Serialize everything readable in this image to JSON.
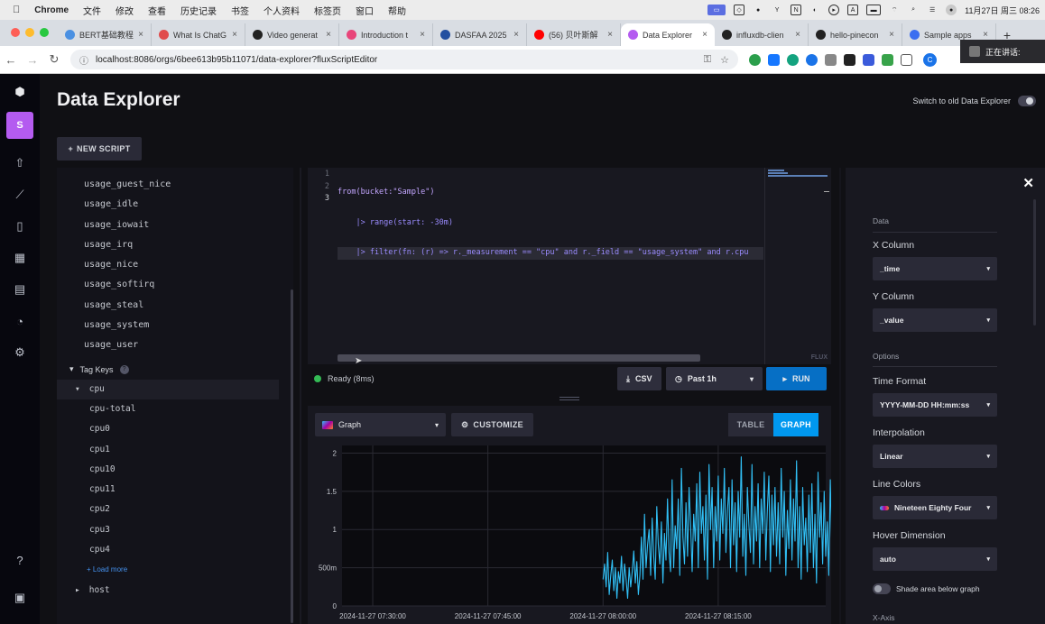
{
  "macos": {
    "app_name": "Chrome",
    "menus": [
      "文件",
      "修改",
      "查看",
      "历史记录",
      "书签",
      "个人资料",
      "标签页",
      "窗口",
      "帮助"
    ],
    "clock": "11月27日 周三 08:26",
    "screen_share_label": "正在讲话:"
  },
  "browser": {
    "tabs": [
      {
        "label": "BERT基础教程",
        "color": "#4a90e2"
      },
      {
        "label": "What Is ChatG",
        "color": "#e04c4c"
      },
      {
        "label": "Video generat",
        "color": "#222222"
      },
      {
        "label": "Introduction t",
        "color": "#e8457a"
      },
      {
        "label": "DASFAA 2025",
        "color": "#2350a0"
      },
      {
        "label": "(56) 贝叶斯解",
        "color": "#ff0000"
      },
      {
        "label": "Data Explorer",
        "color": "#b45bf0"
      },
      {
        "label": "influxdb-clien",
        "color": "#222222"
      },
      {
        "label": "hello-pinecon",
        "color": "#222222"
      },
      {
        "label": "Sample apps",
        "color": "#3b6ef0"
      }
    ],
    "active_tab": 6,
    "url": "localhost:8086/orgs/6bee613b95b11071/data-explorer?fluxScriptEditor",
    "profile_initial": "C"
  },
  "sidebar": {
    "avatar_initial": "S",
    "icons": [
      "upload-icon",
      "graph-icon",
      "book-icon",
      "dashboard-icon",
      "calendar-icon",
      "bell-icon",
      "gear-icon"
    ],
    "bottom_icons": [
      "help-icon",
      "collapse-icon"
    ]
  },
  "page": {
    "title": "Data Explorer",
    "switch_label": "Switch to old Data Explorer",
    "new_script_label": "NEW SCRIPT"
  },
  "schema": {
    "fields": [
      "usage_guest_nice",
      "usage_idle",
      "usage_iowait",
      "usage_irq",
      "usage_nice",
      "usage_softirq",
      "usage_steal",
      "usage_system",
      "usage_user"
    ],
    "tag_keys_label": "Tag Keys",
    "tag_key_cpu": "cpu",
    "cpu_values": [
      "cpu-total",
      "cpu0",
      "cpu1",
      "cpu10",
      "cpu11",
      "cpu2",
      "cpu3",
      "cpu4"
    ],
    "load_more": "+ Load more",
    "tag_key_host": "host"
  },
  "editor": {
    "lines": [
      "from(bucket:\"Sample\")",
      "    |> range(start: -30m)",
      "    |> filter(fn: (r) => r._measurement == \"cpu\" and r._field == \"usage_system\" and r.cpu"
    ],
    "language_badge": "FLUX"
  },
  "status": {
    "ready_text": "Ready (8ms)",
    "csv_label": "CSV",
    "time_range": "Past 1h",
    "run_label": "RUN"
  },
  "visualization": {
    "graph_type": "Graph",
    "customize_label": "CUSTOMIZE",
    "table_label": "TABLE",
    "graph_label": "GRAPH"
  },
  "chart_data": {
    "type": "line",
    "title": "",
    "xlabel": "",
    "ylabel": "",
    "y_tick_labels": [
      "0",
      "500m",
      "1",
      "1.5",
      "2"
    ],
    "y_ticks": [
      0,
      0.5,
      1,
      1.5,
      2
    ],
    "x_tick_labels": [
      "2024-11-27 07:30:00",
      "2024-11-27 07:45:00",
      "2024-11-27 08:00:00",
      "2024-11-27 08:15:00"
    ],
    "x_ticks_minutes": [
      0,
      15,
      30,
      45
    ],
    "x_range_minutes": [
      -4,
      59
    ],
    "ylim": [
      0,
      2.1
    ],
    "line_color": "#31c0f6",
    "grid": true,
    "series": [
      {
        "start_minute": 30,
        "step_minutes": 0.2,
        "values": [
          0.35,
          0.55,
          0.25,
          0.7,
          0.15,
          0.4,
          0.6,
          0.2,
          0.5,
          0.1,
          0.45,
          0.3,
          0.65,
          0.2,
          0.55,
          0.35,
          0.1,
          0.5,
          0.25,
          0.45,
          0.72,
          0.3,
          0.58,
          0.15,
          0.4,
          0.9,
          0.35,
          1.2,
          0.5,
          0.8,
          1.0,
          0.4,
          1.15,
          0.65,
          0.35,
          1.3,
          0.8,
          0.55,
          1.1,
          0.3,
          0.95,
          0.6,
          1.4,
          0.7,
          0.45,
          1.65,
          0.5,
          1.05,
          0.75,
          1.4,
          0.4,
          1.8,
          0.9,
          0.55,
          1.35,
          0.65,
          1.55,
          1.05,
          0.45,
          1.2,
          0.85,
          1.6,
          0.5,
          1.75,
          0.95,
          1.3,
          0.6,
          1.45,
          0.35,
          1.85,
          1.0,
          1.55,
          0.5,
          1.3,
          0.85,
          1.7,
          0.6,
          1.4,
          0.95,
          1.8,
          0.7,
          1.25,
          1.55,
          0.5,
          1.65,
          0.8,
          1.35,
          0.45,
          1.5,
          0.9,
          1.95,
          0.65,
          1.2,
          0.4,
          1.55,
          1.05,
          0.7,
          1.85,
          0.55,
          1.3,
          0.85,
          1.6,
          0.5,
          1.4,
          0.95,
          1.75,
          0.6,
          1.25,
          1.7,
          0.45,
          1.45,
          0.8,
          1.55,
          0.65,
          1.35,
          0.55,
          1.8,
          0.9,
          1.5,
          0.4,
          1.25,
          0.75,
          1.65,
          0.6,
          1.4,
          0.85,
          1.9,
          0.5,
          1.3,
          0.35,
          1.55,
          0.8,
          1.15,
          0.45,
          1.45,
          0.7,
          1.6,
          0.5,
          1.2,
          0.3,
          1.75,
          0.9,
          1.35,
          0.55,
          1.5,
          0.65,
          1.1,
          0.4,
          1.65,
          0.75,
          2.0,
          0.5,
          1.4,
          0.85,
          1.55,
          0.45,
          1.25,
          0.7,
          1.8,
          0.35,
          1.45,
          0.15,
          1.6,
          0.55,
          1.95,
          0.6,
          1.3,
          0.05,
          1.15,
          0.4
        ]
      }
    ]
  },
  "settings": {
    "data_section": "Data",
    "x_column_label": "X Column",
    "x_column_value": "_time",
    "y_column_label": "Y Column",
    "y_column_value": "_value",
    "options_section": "Options",
    "time_format_label": "Time Format",
    "time_format_value": "YYYY-MM-DD HH:mm:ss",
    "interpolation_label": "Interpolation",
    "interpolation_value": "Linear",
    "line_colors_label": "Line Colors",
    "line_colors_value": "Nineteen Eighty Four",
    "hover_dimension_label": "Hover Dimension",
    "hover_dimension_value": "auto",
    "shade_label": "Shade area below graph",
    "x_axis_section": "X-Axis"
  }
}
